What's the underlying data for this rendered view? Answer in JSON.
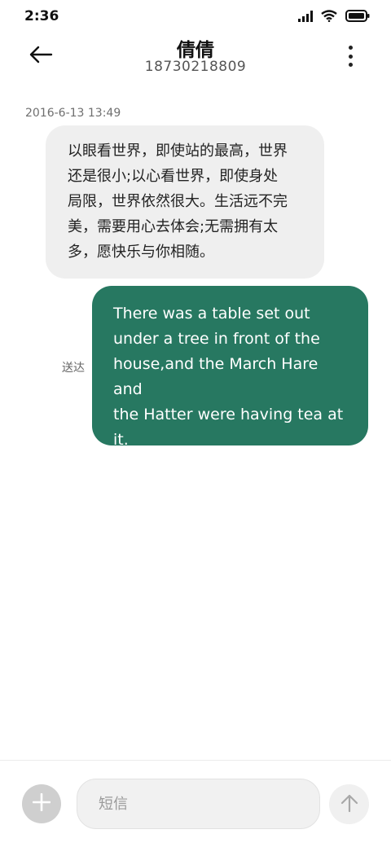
{
  "status_bar": {
    "time": "2:36",
    "icons": [
      "signal-icon",
      "wifi-icon",
      "battery-icon"
    ]
  },
  "header": {
    "title": "倩倩",
    "subtitle": "18730218809",
    "back_icon": "arrow-left-icon",
    "more_icon": "more-vertical-icon"
  },
  "conversation": {
    "timestamp": "2016-6-13 13:49",
    "messages": [
      {
        "direction": "incoming",
        "lines": [
          "以眼看世界，即使站的最高，世界",
          "还是很小;以心看世界，即使身处",
          "局限，世界依然很大。生活远不完",
          "美，需要用心去体会;无需拥有太",
          "多，愿快乐与你相随。"
        ],
        "bubble_color": "#efefef"
      },
      {
        "direction": "outgoing",
        "status": "送达",
        "lines": [
          "There was a table set out",
          "under a tree in front of the",
          "house,and the March Hare and",
          "the Hatter were having tea at",
          "it."
        ],
        "bubble_color": "#277861"
      }
    ]
  },
  "composer": {
    "placeholder": "短信",
    "value": "",
    "attach_icon": "plus-icon",
    "send_icon": "arrow-up-icon"
  }
}
